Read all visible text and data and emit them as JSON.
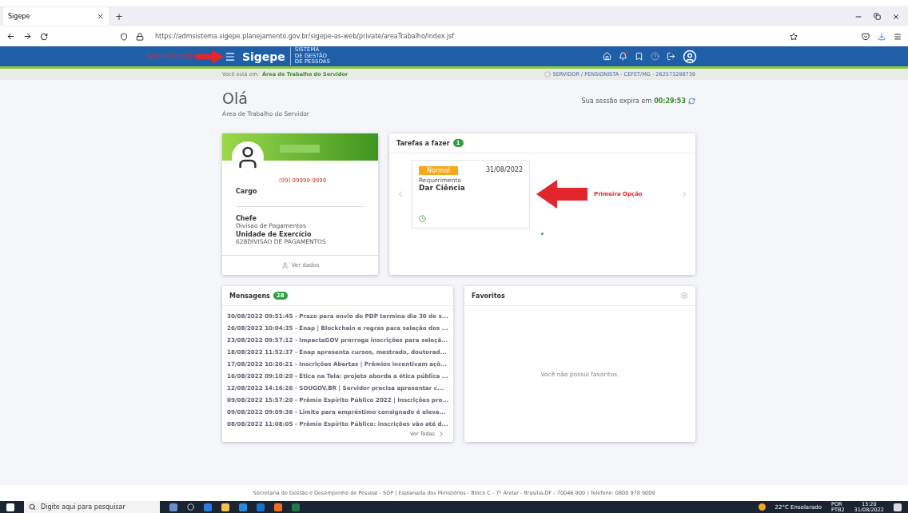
{
  "browser": {
    "tab_title": "Sigepe",
    "new_tab": "+",
    "url": "https://admsistema.sigepe.planejamento.gov.br/sigepe-as-web/private/areaTrabalho/index.jsf"
  },
  "header": {
    "annotation": "Segunda opção",
    "logo": "Sigepe",
    "logo_sub": [
      "SISTEMA",
      "DE GESTÃO",
      "DE PESSOAS"
    ]
  },
  "breadcrumb": {
    "prefix": "Você está em:",
    "current": "Área de Trabalho do Servidor",
    "profile": "SERVIDOR / PENSIONISTA - CEFET/MG - 262573298739"
  },
  "greeting": {
    "title": "Olá",
    "subtitle": "Área de Trabalho do Servidor",
    "session_label": "Sua sessão expira em",
    "session_time": "00:29:53"
  },
  "profile": {
    "phone": "(99) 99999-9999",
    "role_label": "Cargo",
    "function_label": "Chefe",
    "function_value": "Divisao de Pagamentos",
    "unit_label": "Unidade de Exercício",
    "unit_value": "628DIVISAO DE PAGAMENTOS",
    "link": "Ver dados"
  },
  "tasks": {
    "title": "Tarefas a fazer",
    "count": "1",
    "annotation": "Primeira Opção",
    "items": [
      {
        "priority": "Normal",
        "date": "31/08/2022",
        "type": "Requerimento",
        "title": "Dar Ciência"
      }
    ]
  },
  "messages": {
    "title": "Mensagens",
    "count": "28",
    "more": "Ver Todas",
    "items": [
      "30/08/2022 09:51:45 - Prazo para envio do PDP termina dia 30 de s...",
      "26/08/2022 10:04:35 - Enap | Blockchain e regras para seleção dos ...",
      "23/08/2022 09:57:12 - ImpactaGOV prorroga inscrições para seleçã...",
      "18/08/2022 11:52:37 - Enap apresenta cursos, mestrado, doutorad...",
      "17/08/2022 10:20:21 - Inscrições Abertas | Prêmios incentivam açõ...",
      "16/08/2022 09:10:20 - Ética na Tela: projeto aborda a ética pública ...",
      "12/08/2022 14:16:26 - SOUGOV.BR | Servidor precisa apresentar c...",
      "09/08/2022 15:57:20 - Prêmio Espírito Público 2022 | Inscrições pro...",
      "09/08/2022 09:09:36 - Limite para empréstimo consignado é eleva...",
      "08/08/2022 11:08:05 - Prêmio Espírito Público: inscrições vão até d..."
    ]
  },
  "favorites": {
    "title": "Favoritos",
    "empty": "Você não possui favoritos."
  },
  "footer": "Secretaria de Gestão e Desempenho de Pessoal - SGP | Esplanada dos Ministérios - Bloco C - 7º Andar - Brasília-DF - 70046-900 | Telefone: 0800 978 9009",
  "taskbar": {
    "search_placeholder": "Digite aqui para pesquisar",
    "weather": "22°C Ensolarado",
    "language": [
      "POR",
      "PTB2"
    ],
    "time": "13:20",
    "date": "31/08/2022"
  }
}
